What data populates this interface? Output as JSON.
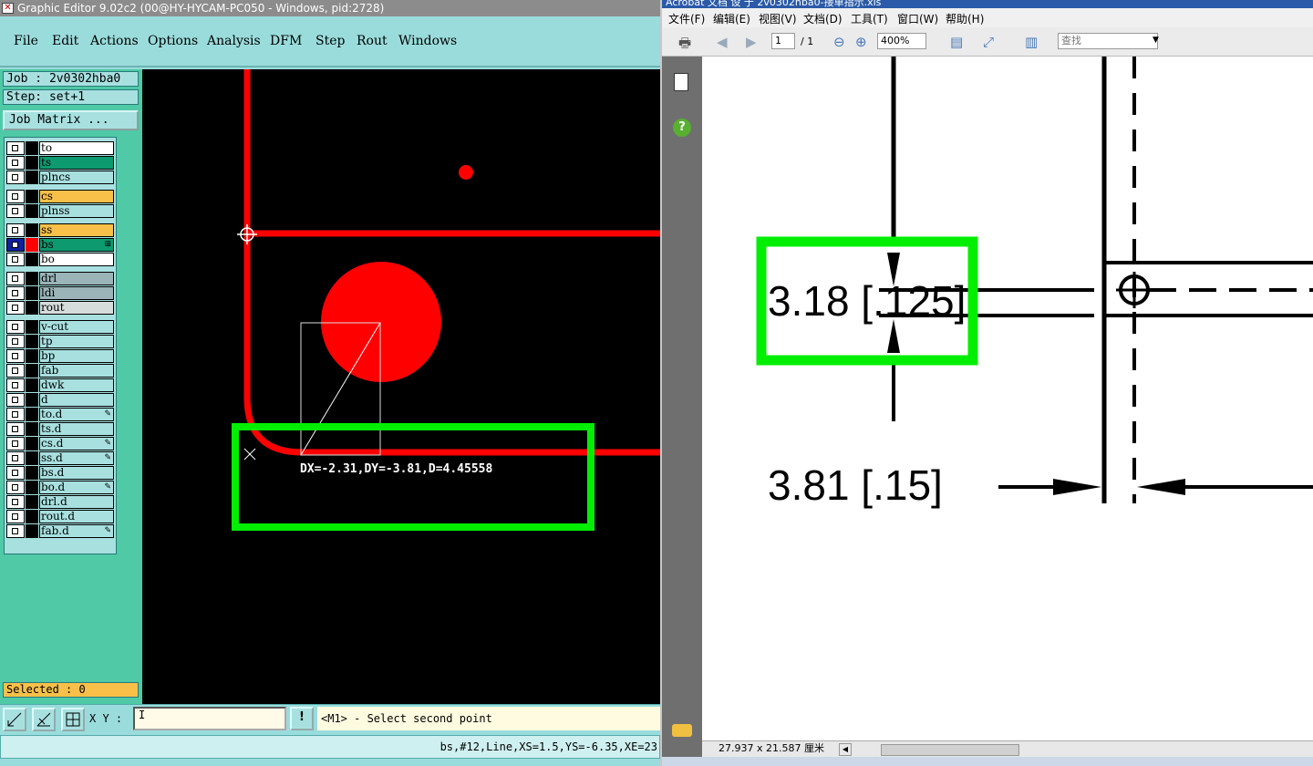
{
  "graphic_editor": {
    "title": "Graphic Editor 9.02c2 (00@HY-HYCAM-PC050 - Windows, pid:2728)",
    "menu": [
      "File",
      "Edit",
      "Actions",
      "Options",
      "Analysis",
      "DFM",
      "Step",
      "Rout",
      "Windows"
    ],
    "job_label": "Job : 2v0302hba0",
    "step_label": "Step: set+1",
    "job_matrix_button": "Job Matrix ...",
    "layers": [
      {
        "name": "to",
        "color": "#ffffff",
        "selected": false,
        "tag": ""
      },
      {
        "name": "ts",
        "color": "#0c9a6e",
        "selected": false,
        "tag": ""
      },
      {
        "name": "plncs",
        "color": "#a8e0e0",
        "selected": false,
        "tag": ""
      },
      {
        "name": "cs",
        "color": "#f8c048",
        "selected": false,
        "tag": ""
      },
      {
        "name": "plnss",
        "color": "#a8e0e0",
        "selected": false,
        "tag": ""
      },
      {
        "name": "ss",
        "color": "#f8c048",
        "selected": false,
        "tag": ""
      },
      {
        "name": "bs",
        "color": "#0c9a6e",
        "selected": true,
        "tag": "⊞"
      },
      {
        "name": "bo",
        "color": "#ffffff",
        "selected": false,
        "tag": ""
      },
      {
        "name": "drl",
        "color": "#9ab4b8",
        "selected": false,
        "tag": ""
      },
      {
        "name": "ldi",
        "color": "#9ab4b8",
        "selected": false,
        "tag": ""
      },
      {
        "name": "rout",
        "color": "#d6dcdc",
        "selected": false,
        "tag": ""
      },
      {
        "name": "v-cut",
        "color": "#a8e0e0",
        "selected": false,
        "tag": ""
      },
      {
        "name": "tp",
        "color": "#a8e0e0",
        "selected": false,
        "tag": ""
      },
      {
        "name": "bp",
        "color": "#a8e0e0",
        "selected": false,
        "tag": ""
      },
      {
        "name": "fab",
        "color": "#a8e0e0",
        "selected": false,
        "tag": ""
      },
      {
        "name": "dwk",
        "color": "#a8e0e0",
        "selected": false,
        "tag": ""
      },
      {
        "name": "d",
        "color": "#a8e0e0",
        "selected": false,
        "tag": ""
      },
      {
        "name": "to.d",
        "color": "#a8e0e0",
        "selected": false,
        "tag": "✎"
      },
      {
        "name": "ts.d",
        "color": "#a8e0e0",
        "selected": false,
        "tag": ""
      },
      {
        "name": "cs.d",
        "color": "#a8e0e0",
        "selected": false,
        "tag": "✎"
      },
      {
        "name": "ss.d",
        "color": "#a8e0e0",
        "selected": false,
        "tag": "✎"
      },
      {
        "name": "bs.d",
        "color": "#a8e0e0",
        "selected": false,
        "tag": ""
      },
      {
        "name": "bo.d",
        "color": "#a8e0e0",
        "selected": false,
        "tag": "✎"
      },
      {
        "name": "drl.d",
        "color": "#a8e0e0",
        "selected": false,
        "tag": ""
      },
      {
        "name": "rout.d",
        "color": "#a8e0e0",
        "selected": false,
        "tag": ""
      },
      {
        "name": "fab.d",
        "color": "#a8e0e0",
        "selected": false,
        "tag": "✎"
      }
    ],
    "selected_label": "Selected : 0",
    "measurement": "DX=-2.31,DY=-3.81,D=4.45558",
    "xy_label": "X Y :",
    "xy_value": "I",
    "bang_label": "!",
    "prompt": "<M1> - Select second point",
    "status_line": "bs,#12,Line,XS=1.5,YS=-6.35,XE=23",
    "feature_color": "#ff0000",
    "highlight_color": "#00ee00"
  },
  "acrobat": {
    "title": "Acrobat 文档 设 于 2v0302hba0-接单指示.xls",
    "menu": [
      "文件(F)",
      "编辑(E)",
      "视图(V)",
      "文档(D)",
      "工具(T)",
      "窗口(W)",
      "帮助(H)"
    ],
    "page_current": "1",
    "page_total": "/ 1",
    "zoom": "400%",
    "search_placeholder": "查找",
    "dimension_top": "3.18 [.125]",
    "dimension_bottom": "3.81 [.15]",
    "page_size": "27.937 x 21.587 厘米"
  }
}
